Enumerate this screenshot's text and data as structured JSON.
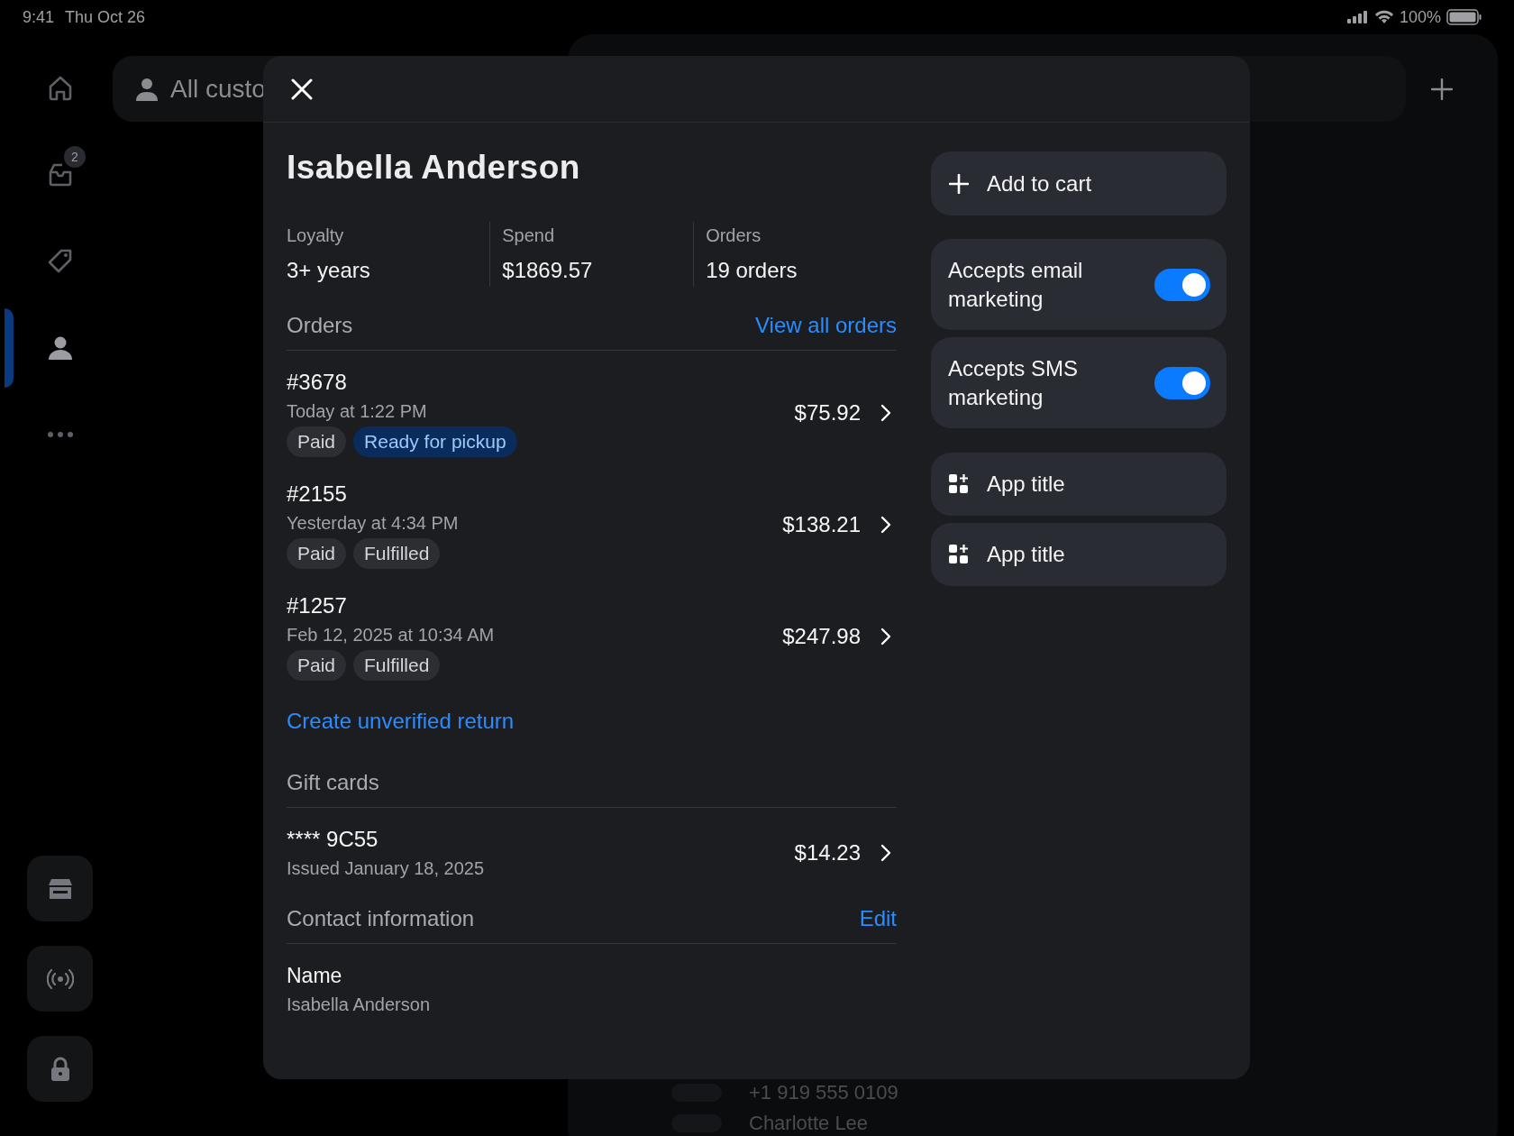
{
  "status_bar": {
    "time": "9:41",
    "date": "Thu Oct 26",
    "battery": "100%"
  },
  "sidebar": {
    "items": [
      {
        "selected": false
      },
      {
        "selected": false,
        "badge": "2"
      },
      {
        "selected": false
      },
      {
        "selected": true
      },
      {
        "selected": false
      }
    ]
  },
  "background": {
    "filter_label": "All custo",
    "list_partial": [
      "+1 919 555 0109",
      "Charlotte Lee"
    ]
  },
  "customer": {
    "name": "Isabella Anderson",
    "stats": [
      {
        "label": "Loyalty",
        "value": "3+ years"
      },
      {
        "label": "Spend",
        "value": "$1869.57"
      },
      {
        "label": "Orders",
        "value": "19 orders"
      }
    ],
    "orders": {
      "title": "Orders",
      "link": "View all orders",
      "items": [
        {
          "number": "#3678",
          "date": "Today at 1:22 PM",
          "total": "$75.92",
          "badges": [
            {
              "label": "Paid",
              "kind": "neutral"
            },
            {
              "label": "Ready for pickup",
              "kind": "info"
            }
          ]
        },
        {
          "number": "#2155",
          "date": "Yesterday at 4:34 PM",
          "total": "$138.21",
          "badges": [
            {
              "label": "Paid",
              "kind": "neutral"
            },
            {
              "label": "Fulfilled",
              "kind": "neutral"
            }
          ]
        },
        {
          "number": "#1257",
          "date": "Feb 12, 2025 at 10:34 AM",
          "total": "$247.98",
          "badges": [
            {
              "label": "Paid",
              "kind": "neutral"
            },
            {
              "label": "Fulfilled",
              "kind": "neutral"
            }
          ]
        }
      ]
    },
    "return_link": "Create unverified return",
    "gift_cards": {
      "title": "Gift cards",
      "items": [
        {
          "code": "**** 9C55",
          "issued": "Issued January 18, 2025",
          "balance": "$14.23"
        }
      ]
    },
    "contact": {
      "title": "Contact information",
      "link": "Edit",
      "fields": [
        {
          "label": "Name",
          "value": "Isabella Anderson"
        }
      ]
    },
    "actions": [
      {
        "label": "Add to cart"
      }
    ],
    "toggles": [
      {
        "label": "Accepts email marketing",
        "on": true
      },
      {
        "label": "Accepts SMS marketing",
        "on": true
      }
    ],
    "apps": [
      {
        "label": "App title"
      },
      {
        "label": "App title"
      }
    ]
  }
}
